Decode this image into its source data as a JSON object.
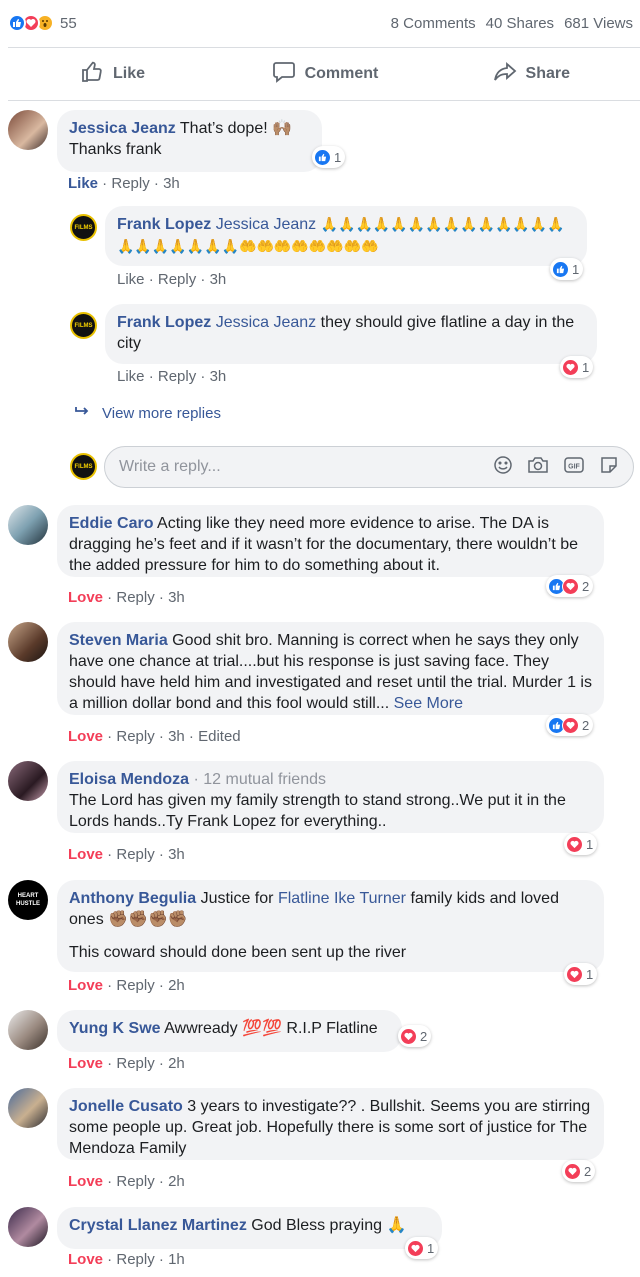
{
  "stats": {
    "reaction_count": "55",
    "comments": "8 Comments",
    "shares": "40 Shares",
    "views": "681 Views"
  },
  "actions": {
    "like": "Like",
    "comment": "Comment",
    "share": "Share"
  },
  "comments": [
    {
      "name": "Jessica Jeanz",
      "text": "That’s dope! 🙌🏽",
      "text2": "Thanks frank",
      "like": "Like",
      "reply": "Reply",
      "time": "3h",
      "react_count": "1"
    },
    {
      "name": "Frank Lopez",
      "mention": "Jessica Jeanz",
      "text": "🙏🙏🙏🙏🙏🙏🙏🙏🙏🙏🙏🙏🙏🙏🙏🙏🙏🙏🙏🙏🙏🤲🤲🤲🤲🤲🤲🤲🤲",
      "like": "Like",
      "reply": "Reply",
      "time": "3h",
      "react_count": "1"
    },
    {
      "name": "Frank Lopez",
      "mention": "Jessica Jeanz",
      "text": "they should give flatline a day in the city",
      "like": "Like",
      "reply": "Reply",
      "time": "3h",
      "react_count": "1"
    },
    {
      "name": "Eddie Caro",
      "text": "Acting like they need more evidence to arise. The DA is dragging he’s feet and if it wasn’t for the documentary, there wouldn’t be the added pressure for him to do something about it.",
      "love": "Love",
      "reply": "Reply",
      "time": "3h",
      "react_count": "2"
    },
    {
      "name": "Steven Maria",
      "text": "Good shit bro. Manning is correct when he says they only have one chance at trial....but his response is just saving face. They should have held him and investigated and reset until the trial. Murder 1 is a million dollar bond and this fool would still...",
      "see_more": "See More",
      "love": "Love",
      "reply": "Reply",
      "time": "3h",
      "edited": "Edited",
      "react_count": "2"
    },
    {
      "name": "Eloisa Mendoza",
      "mutual": "12 mutual friends",
      "text": "The Lord has given my family strength to stand strong..We put it in the Lords hands..Ty Frank Lopez for everything..",
      "love": "Love",
      "reply": "Reply",
      "time": "3h",
      "react_count": "1"
    },
    {
      "name": "Anthony Begulia",
      "text_a": "Justice for",
      "mention": "Flatline Ike Turner",
      "text_b": "family kids and loved ones ✊🏽✊🏽✊🏽✊🏽",
      "text2": "This coward should done been sent up the river",
      "love": "Love",
      "reply": "Reply",
      "time": "2h",
      "react_count": "1"
    },
    {
      "name": "Yung K Swe",
      "text": "Awwready 💯💯 R.I.P Flatline",
      "love": "Love",
      "reply": "Reply",
      "time": "2h",
      "react_count": "2"
    },
    {
      "name": "Jonelle Cusato",
      "text": "3 years to investigate?? . Bullshit. Seems you are stirring some people up. Great job. Hopefully there is some sort of justice for The Mendoza Family",
      "love": "Love",
      "reply": "Reply",
      "time": "2h",
      "react_count": "2"
    },
    {
      "name": "Crystal Llanez Martinez",
      "text": "God Bless praying 🙏",
      "love": "Love",
      "reply": "Reply",
      "time": "1h",
      "react_count": "1"
    }
  ],
  "view_more": "View more replies",
  "reply_box": {
    "placeholder": "Write a reply..."
  },
  "avatar_badge": "FILMS",
  "avatar_badge2": "HEART HUSTLE",
  "colors": {
    "link": "#385898",
    "love": "#f33e58",
    "like": "#1877f2",
    "bubble": "#f2f3f5"
  }
}
